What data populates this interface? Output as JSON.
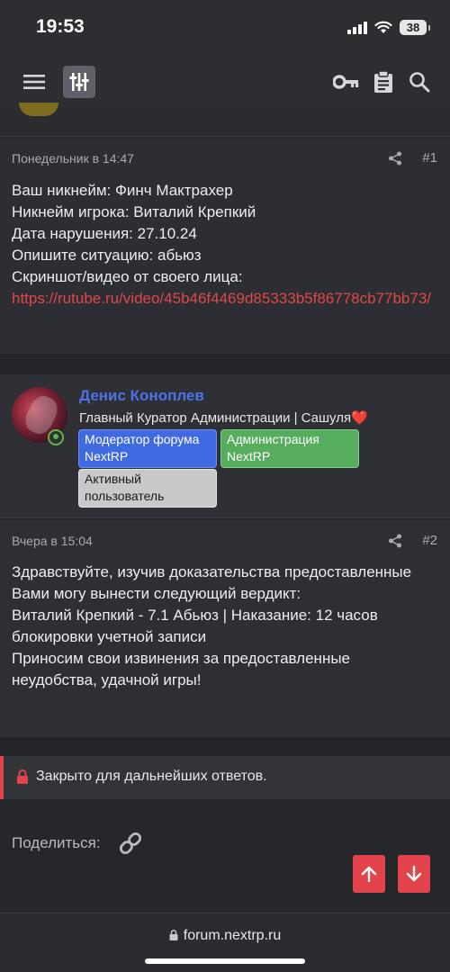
{
  "status_bar": {
    "time": "19:53",
    "battery": "38"
  },
  "post1": {
    "date": "Понедельник в 14:47",
    "number": "#1",
    "lines": [
      "Ваш никнейм: Финч Мактрахер",
      "Никнейм игрока: Виталий Крепкий",
      "Дата нарушения: 27.10.24",
      "Опишите ситуацию: абьюз",
      "Скриншот/видео от своего лица:"
    ],
    "link": "https://rutube.ru/video/45b46f4469d85333b5f86778cb77bb73/"
  },
  "user": {
    "name": "Денис Коноплев",
    "title": "Главный Куратор Администрации | Сашуля",
    "title_emoji": "❤️",
    "badges": {
      "moderator": "Модератор форума NextRP",
      "admin": "Администрация NextRP",
      "active": "Активный пользователь"
    }
  },
  "post2": {
    "date": "Вчера в 15:04",
    "number": "#2",
    "lines": [
      "Здравствуйте, изучив доказательства предоставленные Вами могу вынести следующий вердикт:",
      "Виталий Крепкий - 7.1 Абьюз | Наказание: 12 часов блокировки учетной записи",
      "Приносим свои извинения за предоставленные неудобства, удачной игры!"
    ]
  },
  "closed_notice": "Закрыто для дальнейших ответов.",
  "share_label": "Поделиться:",
  "url": "forum.nextrp.ru",
  "colors": {
    "accent_red": "#e3434b",
    "username_blue": "#4d72e8",
    "admin_green": "#55ad5d",
    "moderator_blue": "#3f6ae2"
  }
}
